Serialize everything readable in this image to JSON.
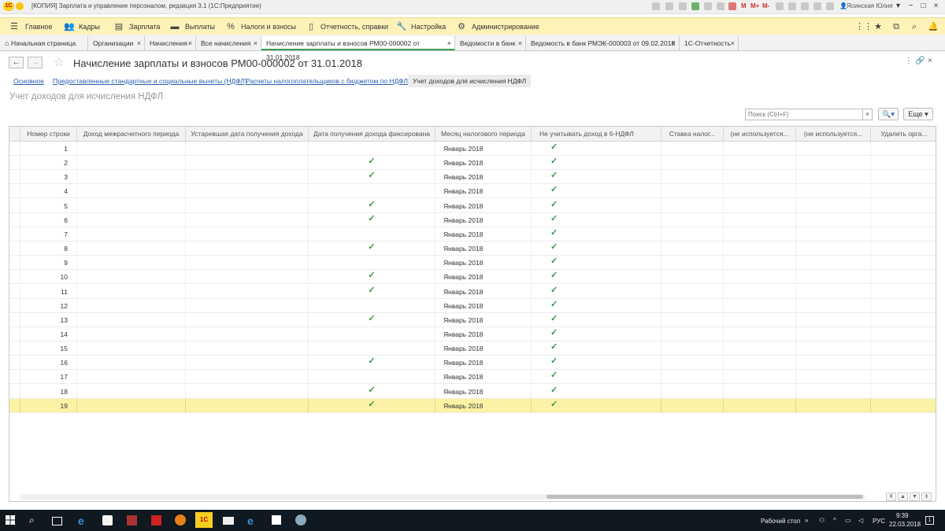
{
  "window": {
    "title": "[КОПИЯ] Зарплата и управление персоналом, редакция 3.1 (1С:Предприятие)",
    "logo_text": "1С",
    "toolbar_m": "M",
    "toolbar_mplus": "M+",
    "toolbar_mminus": "M-",
    "user": "Ясинская Юлия"
  },
  "menu": [
    {
      "label": "Главное",
      "icon": "menu-hamburger-icon"
    },
    {
      "label": "Кадры",
      "icon": "people-icon"
    },
    {
      "label": "Зарплата",
      "icon": "wallet-icon"
    },
    {
      "label": "Выплаты",
      "icon": "card-icon"
    },
    {
      "label": "Налоги и взносы",
      "icon": "percent-icon"
    },
    {
      "label": "Отчетность, справки",
      "icon": "report-icon"
    },
    {
      "label": "Настройка",
      "icon": "wrench-icon"
    },
    {
      "label": "Администрирование",
      "icon": "gear-icon"
    }
  ],
  "tabs": [
    {
      "label": "Начальная страница"
    },
    {
      "label": "Организации"
    },
    {
      "label": "Начисления"
    },
    {
      "label": "Все начисления"
    },
    {
      "label": "Начисление зарплаты и взносов РМ00-000002 от 31.01.2018"
    },
    {
      "label": "Ведомости в банк"
    },
    {
      "label": "Ведомость в банк РМЭК-000003 от 09.02.2018"
    },
    {
      "label": "1С-Отчетность"
    }
  ],
  "form": {
    "title": "Начисление зарплаты и взносов РМ00-000002 от 31.01.2018",
    "sections": [
      "Основное",
      "Предоставленные стандартные и социальные вычеты (НДФЛ)",
      "Расчеты налогоплательщиков с бюджетом по НДФЛ",
      "Учет доходов для исчисления НДФЛ"
    ],
    "panel_title": "Учет доходов для исчисления НДФЛ",
    "search_placeholder": "Поиск (Ctrl+F)",
    "search_clear": "×",
    "search_btn": "🔍▾",
    "more_btn": "Еще ▾"
  },
  "table": {
    "columns": [
      "Номер строки",
      "Доход межрасчетного периода",
      "Устаревшая дата получения дохода",
      "Дата получения дохода фиксирована",
      "Месяц налогового периода",
      "Не учитывать доход в 6-НДФЛ",
      "Ставка налог...",
      "(не используется...",
      "(не используется...",
      "Удалить орга..."
    ],
    "rows": [
      {
        "n": "1",
        "fixed": "",
        "month": "",
        "noacc": "✓"
      },
      {
        "n": "2",
        "fixed": "✓",
        "month": "Январь 2018",
        "noacc": "✓"
      },
      {
        "n": "3",
        "fixed": "✓",
        "month": "Январь 2018",
        "noacc": "✓"
      },
      {
        "n": "4",
        "fixed": "",
        "month": "Январь 2018",
        "noacc": "✓"
      },
      {
        "n": "5",
        "fixed": "✓",
        "month": "Январь 2018",
        "noacc": "✓"
      },
      {
        "n": "6",
        "fixed": "✓",
        "month": "Январь 2018",
        "noacc": "✓"
      },
      {
        "n": "7",
        "fixed": "",
        "month": "Январь 2018",
        "noacc": "✓"
      },
      {
        "n": "8",
        "fixed": "✓",
        "month": "Январь 2018",
        "noacc": "✓"
      },
      {
        "n": "9",
        "fixed": "",
        "month": "Январь 2018",
        "noacc": "✓"
      },
      {
        "n": "10",
        "fixed": "✓",
        "month": "Январь 2018",
        "noacc": "✓"
      },
      {
        "n": "11",
        "fixed": "✓",
        "month": "Январь 2018",
        "noacc": "✓"
      },
      {
        "n": "12",
        "fixed": "",
        "month": "Январь 2018",
        "noacc": "✓"
      },
      {
        "n": "13",
        "fixed": "✓",
        "month": "Январь 2018",
        "noacc": "✓"
      },
      {
        "n": "14",
        "fixed": "",
        "month": "Январь 2018",
        "noacc": "✓"
      },
      {
        "n": "15",
        "fixed": "",
        "month": "Январь 2018",
        "noacc": "✓"
      },
      {
        "n": "16",
        "fixed": "✓",
        "month": "Январь 2018",
        "noacc": "✓"
      },
      {
        "n": "17",
        "fixed": "",
        "month": "Январь 2018",
        "noacc": "✓"
      },
      {
        "n": "18",
        "fixed": "✓",
        "month": "Январь 2018",
        "noacc": "✓"
      },
      {
        "n": "19",
        "fixed": "✓",
        "month": "Январь 2018",
        "noacc": "✓"
      }
    ],
    "row1_month": "Январь 2018"
  },
  "taskbar": {
    "desktop_label": "Рабочий стол",
    "lang": "РУС",
    "time": "9:39",
    "date": "22.03.2018",
    "notif": "1"
  }
}
